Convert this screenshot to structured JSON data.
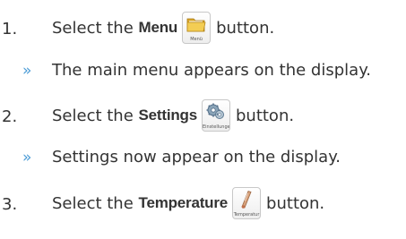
{
  "steps": [
    {
      "number": "1.",
      "prefix": "Select the ",
      "bold": "Menu",
      "button_icon": "folder-icon",
      "button_caption": "Menü",
      "suffix": "button."
    },
    {
      "number": "2.",
      "prefix": "Select the ",
      "bold": "Settings",
      "button_icon": "gear-icon",
      "button_caption": "Einstellungen",
      "suffix": "button."
    },
    {
      "number": "3.",
      "prefix": "Select the ",
      "bold": "Temperature",
      "button_icon": "thermometer-icon",
      "button_caption": "Temperatur",
      "suffix": "button."
    }
  ],
  "results": [
    {
      "marker": "»",
      "text": "The main menu appears on the display."
    },
    {
      "marker": "»",
      "text": "Settings now appear on the display."
    }
  ],
  "colors": {
    "text": "#333333",
    "result_marker": "#4a9bd6"
  }
}
